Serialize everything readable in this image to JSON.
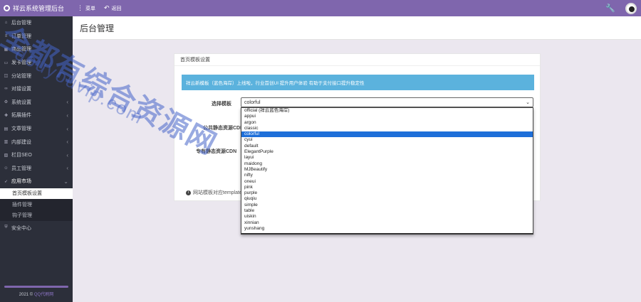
{
  "app": {
    "title": "祥云系统管理后台"
  },
  "topnav": {
    "menu_label": "菜单",
    "back_label": "返回"
  },
  "sidebar": {
    "items_top": [
      {
        "label": "后台管理"
      },
      {
        "label": "订单管理"
      },
      {
        "label": "商品管理"
      },
      {
        "label": "发卡管理"
      },
      {
        "label": "分站管理"
      },
      {
        "label": "对接设置"
      },
      {
        "label": "系统设置"
      },
      {
        "label": "拓展插件"
      },
      {
        "label": "文章管理"
      },
      {
        "label": "内部建设"
      },
      {
        "label": "栏目SEO"
      },
      {
        "label": "员工管理"
      }
    ],
    "app_market": {
      "label": "应用市场",
      "children": [
        "首页模板设置",
        "插件管理",
        "钩子管理"
      ]
    },
    "security": {
      "label": "安全中心"
    },
    "footer_prefix": "2021 © ",
    "footer_link": "QQ代刷网"
  },
  "page": {
    "title": "后台管理"
  },
  "card": {
    "title": "首页模板设置",
    "alert": "祥云新模板（蓝色海岸）上线啦，行业首创UI 提升用户体验 有助于支付接口提升稳定性",
    "label_select": "选择模板",
    "label_cdn_public": "公共静态资源CDN",
    "label_cdn_exclusive": "专有静态资源CDN",
    "tip": "网站模板对应template目"
  },
  "select": {
    "value": "colorful",
    "options": [
      "official (祥云蓝色海岸)",
      "appui",
      "argon",
      "classic",
      "colorful",
      "cyui",
      "default",
      "ElegantPurple",
      "layui",
      "maidong",
      "MJBeautify",
      "nifty",
      "oneui",
      "pink",
      "purple",
      "qiuqiu",
      "simple",
      "table",
      "uiskin",
      "xinnian",
      "yunshang"
    ],
    "selected_index": 4
  },
  "watermark": {
    "line1": "全都有综合资源网",
    "line2": "douyouvip.com"
  }
}
